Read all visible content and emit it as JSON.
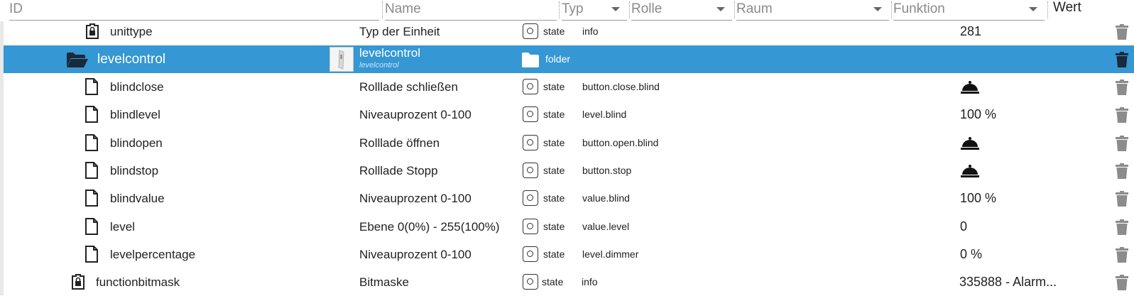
{
  "header": {
    "id_placeholder": "ID",
    "name_placeholder": "Name",
    "typ_placeholder": "Typ",
    "rolle_placeholder": "Rolle",
    "raum_placeholder": "Raum",
    "funktion_placeholder": "Funktion",
    "wert_label": "Wert"
  },
  "rows": [
    {
      "id": "unittype",
      "name": "Typ der Einheit",
      "type": "state",
      "role": "info",
      "value": "281",
      "icon": "lock-file-icon"
    },
    {
      "id": "levelcontrol",
      "name": "levelcontrol",
      "name_sub": "levelcontrol",
      "type": "folder",
      "role": "",
      "value": "",
      "icon": "folder-open-icon",
      "selected": true
    },
    {
      "id": "blindclose",
      "name": "Rolllade schließen",
      "type": "state",
      "role": "button.close.blind",
      "value": "",
      "icon": "file-icon",
      "value_icon": "bell-icon"
    },
    {
      "id": "blindlevel",
      "name": "Niveauprozent 0-100",
      "type": "state",
      "role": "level.blind",
      "value": "100 %",
      "icon": "file-icon"
    },
    {
      "id": "blindopen",
      "name": "Rolllade öffnen",
      "type": "state",
      "role": "button.open.blind",
      "value": "",
      "icon": "file-icon",
      "value_icon": "bell-icon"
    },
    {
      "id": "blindstop",
      "name": "Rolllade Stopp",
      "type": "state",
      "role": "button.stop",
      "value": "",
      "icon": "file-icon",
      "value_icon": "bell-icon"
    },
    {
      "id": "blindvalue",
      "name": "Niveauprozent 0-100",
      "type": "state",
      "role": "value.blind",
      "value": "100 %",
      "icon": "file-icon"
    },
    {
      "id": "level",
      "name": "Ebene 0(0%) - 255(100%)",
      "type": "state",
      "role": "value.level",
      "value": "0",
      "icon": "file-icon"
    },
    {
      "id": "levelpercentage",
      "name": "Niveauprozent 0-100",
      "type": "state",
      "role": "level.dimmer",
      "value": "0 %",
      "icon": "file-icon"
    },
    {
      "id": "functionbitmask",
      "name": "Bitmaske",
      "type": "state",
      "role": "info",
      "value": "335888 - Alarm...",
      "icon": "lock-file-icon"
    }
  ],
  "colors": {
    "selected_bg": "#3597d3",
    "trash": "#8c8c8c"
  }
}
